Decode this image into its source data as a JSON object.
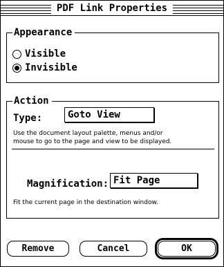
{
  "window": {
    "title": "PDF Link Properties"
  },
  "appearance": {
    "group_label": "Appearance",
    "options": [
      {
        "label": "Visible",
        "checked": false
      },
      {
        "label": "Invisible",
        "checked": true
      }
    ]
  },
  "action": {
    "group_label": "Action",
    "type_label": "Type:",
    "type_value": "Goto View",
    "type_help": "Use the document layout palette, menus and/or mouse to go to the page and view to be displayed.",
    "type_help_line1": "Use the document layout palette, menus and/or",
    "type_help_line2": "mouse to go to the page and view to be displayed.",
    "magnification_label": "Magnification:",
    "magnification_value": "Fit Page",
    "magnification_help": "Fit the current page in the destination window."
  },
  "buttons": {
    "remove": "Remove",
    "cancel": "Cancel",
    "ok": "OK"
  }
}
